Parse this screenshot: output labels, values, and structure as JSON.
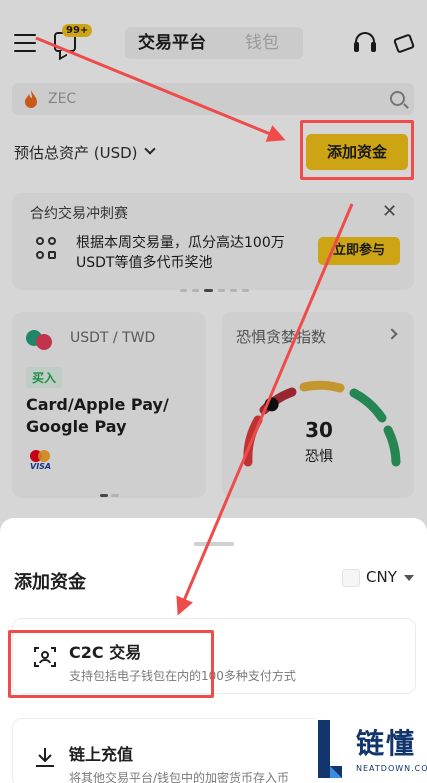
{
  "header": {
    "badge": "99+",
    "tabs": [
      {
        "label": "交易平台",
        "active": true
      },
      {
        "label": "钱包",
        "active": false
      }
    ]
  },
  "search": {
    "text": "ZEC"
  },
  "assets": {
    "label": "预估总资产 (USD)",
    "add_funds_label": "添加资金"
  },
  "promo": {
    "title": "合约交易冲刺赛",
    "description": "根据本周交易量，瓜分高达100万USDT等值多代币奖池",
    "button": "立即参与",
    "close": "✕"
  },
  "p2p": {
    "pair": "USDT / TWD",
    "buy_tag": "买入",
    "payment": "Card/Apple Pay/ Google Pay",
    "visa": "VISA"
  },
  "fear_greed": {
    "title": "恐惧贪婪指数",
    "value": "30",
    "label": "恐惧",
    "level": 0.3
  },
  "sheet": {
    "title": "添加资金",
    "currency": "CNY",
    "options": [
      {
        "title": "C2C 交易",
        "subtitle": "支持包括电子钱包在内的100多种支付方式"
      },
      {
        "title": "链上充值",
        "subtitle": "将其他交易平台/钱包中的加密货币存入币"
      }
    ]
  },
  "watermark": {
    "text": "链懂",
    "sub": "NEATDOWN.COM"
  },
  "colors": {
    "accent": "#f5c518",
    "highlight": "#ef4b4b",
    "buy": "#26a65b"
  }
}
